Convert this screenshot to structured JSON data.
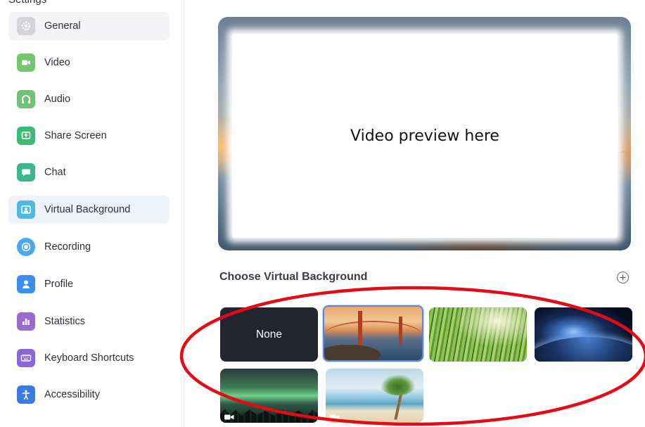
{
  "sidebar": {
    "top_clipped_label": "Settings",
    "items": [
      {
        "label": "General",
        "icon": "gear-icon",
        "color": "#d4d4d9"
      },
      {
        "label": "Video",
        "icon": "video-camera-icon",
        "color": "#76c66d"
      },
      {
        "label": "Audio",
        "icon": "headphones-icon",
        "color": "#6fc278"
      },
      {
        "label": "Share Screen",
        "icon": "share-screen-icon",
        "color": "#3dbb74"
      },
      {
        "label": "Chat",
        "icon": "chat-bubble-icon",
        "color": "#38b98c"
      },
      {
        "label": "Virtual Background",
        "icon": "virtual-background-icon",
        "color": "#4fb9e0"
      },
      {
        "label": "Recording",
        "icon": "record-icon",
        "color": "#4aa8ef"
      },
      {
        "label": "Profile",
        "icon": "person-icon",
        "color": "#3c8df0"
      },
      {
        "label": "Statistics",
        "icon": "bar-chart-icon",
        "color": "#9a6ad0"
      },
      {
        "label": "Keyboard Shortcuts",
        "icon": "keyboard-icon",
        "color": "#8b67d9"
      },
      {
        "label": "Accessibility",
        "icon": "accessibility-icon",
        "color": "#3b7be0"
      }
    ]
  },
  "preview": {
    "text": "Video preview here"
  },
  "backgrounds": {
    "title": "Choose Virtual Background",
    "none_label": "None",
    "items": [
      "None",
      "Golden Gate Bridge",
      "Grass",
      "Earth from space",
      "Aurora",
      "Beach"
    ],
    "selected": "Golden Gate Bridge"
  },
  "colors": {
    "accent": "#5788d8",
    "annotation": "#e30b16"
  }
}
